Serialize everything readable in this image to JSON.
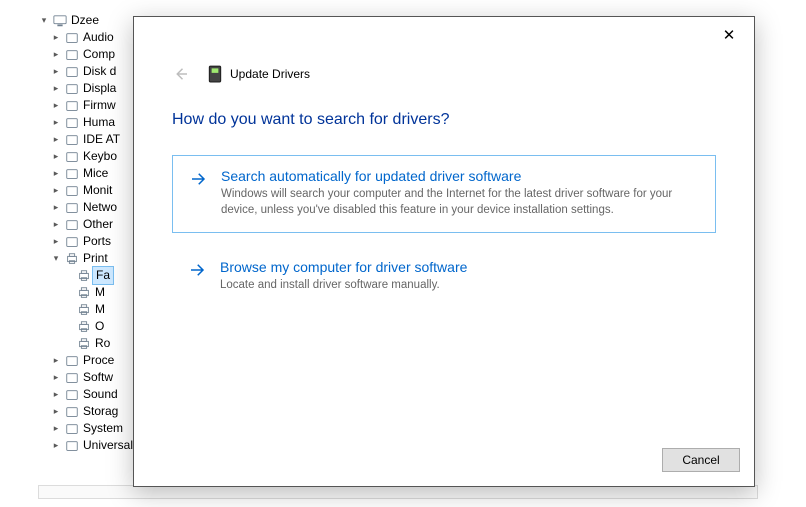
{
  "tree": {
    "root": "Dzee",
    "items": [
      {
        "label": "Audio",
        "icon": "speaker"
      },
      {
        "label": "Comp",
        "icon": "computer"
      },
      {
        "label": "Disk d",
        "icon": "disk"
      },
      {
        "label": "Displa",
        "icon": "display"
      },
      {
        "label": "Firmw",
        "icon": "chip"
      },
      {
        "label": "Huma",
        "icon": "hid"
      },
      {
        "label": "IDE AT",
        "icon": "ide"
      },
      {
        "label": "Keybo",
        "icon": "keyboard"
      },
      {
        "label": "Mice",
        "icon": "mouse"
      },
      {
        "label": "Monit",
        "icon": "monitor"
      },
      {
        "label": "Netwo",
        "icon": "network"
      },
      {
        "label": "Other",
        "icon": "other"
      },
      {
        "label": "Ports",
        "icon": "ports"
      }
    ],
    "printers": {
      "category_label": "Print",
      "children": [
        {
          "label": "Fa",
          "selected": true
        },
        {
          "label": "M"
        },
        {
          "label": "M"
        },
        {
          "label": "O"
        },
        {
          "label": "Ro"
        }
      ]
    },
    "tail": [
      {
        "label": "Proce",
        "icon": "cpu"
      },
      {
        "label": "Softw",
        "icon": "soft"
      },
      {
        "label": "Sound",
        "icon": "sound"
      },
      {
        "label": "Storag",
        "icon": "storage"
      },
      {
        "label": "System",
        "icon": "system"
      },
      {
        "label": "Universal",
        "icon": "usb"
      }
    ]
  },
  "dialog": {
    "title": "Update Drivers",
    "heading": "How do you want to search for drivers?",
    "opt1": {
      "title": "Search automatically for updated driver software",
      "desc": "Windows will search your computer and the Internet for the latest driver software for your device, unless you've disabled this feature in your device installation settings."
    },
    "opt2": {
      "title": "Browse my computer for driver software",
      "desc": "Locate and install driver software manually."
    },
    "cancel": "Cancel"
  }
}
